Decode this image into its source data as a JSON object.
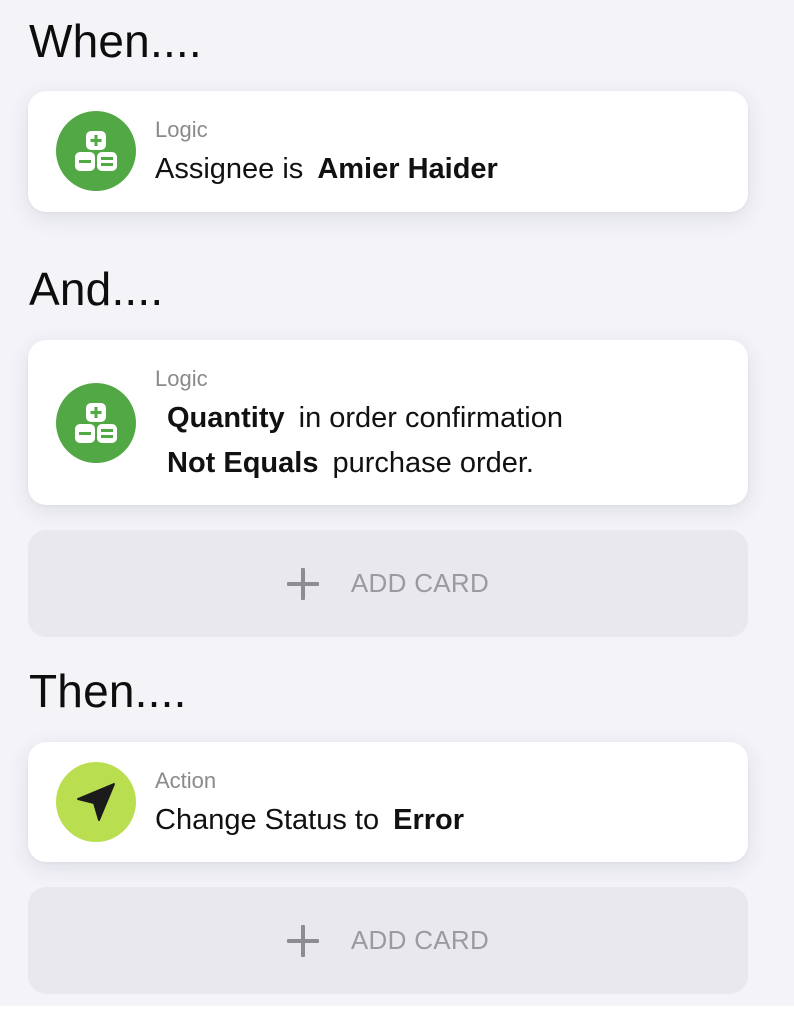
{
  "sections": {
    "when": {
      "heading": "When...."
    },
    "and": {
      "heading": "And...."
    },
    "then": {
      "heading": "Then...."
    }
  },
  "cards": {
    "when_card": {
      "label": "Logic",
      "prefix": "Assignee is",
      "value": "Amier Haider",
      "icon": "logic-calculator-icon",
      "icon_color": "#52a844"
    },
    "and_card": {
      "label": "Logic",
      "line1_bold": "Quantity",
      "line1_text": "in order confirmation",
      "line2_bold": "Not Equals",
      "line2_text": "purchase order.",
      "icon": "logic-calculator-icon",
      "icon_color": "#52a844"
    },
    "then_card": {
      "label": "Action",
      "prefix": "Change Status to",
      "value": "Error",
      "icon": "navigation-arrow-icon",
      "icon_color": "#b9df50"
    }
  },
  "add_card": {
    "label": "ADD CARD",
    "icon": "plus-icon"
  }
}
